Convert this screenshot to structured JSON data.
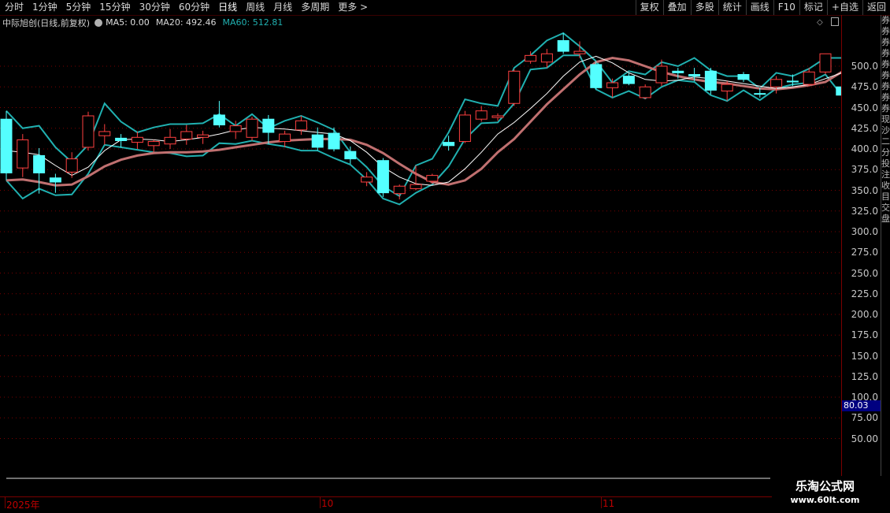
{
  "toolbar": {
    "periods": [
      "分时",
      "1分钟",
      "5分钟",
      "15分钟",
      "30分钟",
      "60分钟",
      "日线",
      "周线",
      "月线",
      "多周期",
      "更多 >"
    ],
    "active_period": "日线",
    "actions": [
      "复权",
      "叠加",
      "多股",
      "统计",
      "画线",
      "F10",
      "标记",
      "+自选",
      "返回"
    ]
  },
  "legend": {
    "title": "中际旭创(日线,前复权)",
    "ma5": "MA5: 0.00",
    "ma20": "MA20: 492.46",
    "ma60": "MA60: 512.81"
  },
  "price_axis": {
    "labels": [
      "500.0",
      "475.0",
      "450.0",
      "425.0",
      "400.0",
      "375.0",
      "350.0",
      "325.0",
      "300.0",
      "275.0",
      "250.0",
      "225.0",
      "200.0",
      "175.0",
      "150.0",
      "125.0",
      "100.0",
      "75.00",
      "50.00"
    ],
    "current_price": "80.03"
  },
  "side_strip": [
    "券",
    "券",
    "券",
    "券",
    "券",
    "券",
    "券",
    "券",
    "券",
    "现",
    "沙",
    "二",
    "分",
    "投",
    "注",
    "收",
    "目",
    "交",
    "盘"
  ],
  "time_axis": {
    "labels": [
      "2025年",
      "10",
      "11"
    ]
  },
  "watermark": {
    "line1": "乐淘公式网",
    "line2": "www.60lt.com"
  },
  "colors": {
    "up": "#ff4040",
    "down": "#54ffff",
    "ma_white": "#ffffff",
    "ma_brown": "#c07070",
    "band": "#20b0b0",
    "grid": "#7a0000"
  },
  "chart_data": {
    "type": "candlestick",
    "ylim": [
      25,
      550
    ],
    "candles": [
      {
        "o": 436,
        "h": 446,
        "l": 362,
        "c": 371
      },
      {
        "o": 377,
        "h": 418,
        "l": 366,
        "c": 411
      },
      {
        "o": 392,
        "h": 401,
        "l": 346,
        "c": 371
      },
      {
        "o": 365,
        "h": 370,
        "l": 347,
        "c": 360
      },
      {
        "o": 372,
        "h": 396,
        "l": 365,
        "c": 388
      },
      {
        "o": 402,
        "h": 445,
        "l": 398,
        "c": 440
      },
      {
        "o": 416,
        "h": 430,
        "l": 405,
        "c": 421
      },
      {
        "o": 413,
        "h": 418,
        "l": 402,
        "c": 410
      },
      {
        "o": 408,
        "h": 421,
        "l": 400,
        "c": 414
      },
      {
        "o": 404,
        "h": 411,
        "l": 396,
        "c": 409
      },
      {
        "o": 406,
        "h": 424,
        "l": 400,
        "c": 414
      },
      {
        "o": 412,
        "h": 429,
        "l": 405,
        "c": 421
      },
      {
        "o": 414,
        "h": 422,
        "l": 406,
        "c": 417
      },
      {
        "o": 441,
        "h": 458,
        "l": 426,
        "c": 429
      },
      {
        "o": 421,
        "h": 434,
        "l": 412,
        "c": 428
      },
      {
        "o": 414,
        "h": 439,
        "l": 410,
        "c": 436
      },
      {
        "o": 436,
        "h": 441,
        "l": 406,
        "c": 420
      },
      {
        "o": 409,
        "h": 422,
        "l": 402,
        "c": 418
      },
      {
        "o": 423,
        "h": 440,
        "l": 417,
        "c": 434
      },
      {
        "o": 417,
        "h": 426,
        "l": 398,
        "c": 402
      },
      {
        "o": 419,
        "h": 426,
        "l": 397,
        "c": 400
      },
      {
        "o": 397,
        "h": 403,
        "l": 382,
        "c": 388
      },
      {
        "o": 360,
        "h": 372,
        "l": 355,
        "c": 366
      },
      {
        "o": 386,
        "h": 389,
        "l": 342,
        "c": 347
      },
      {
        "o": 346,
        "h": 357,
        "l": 339,
        "c": 355
      },
      {
        "o": 352,
        "h": 380,
        "l": 350,
        "c": 357
      },
      {
        "o": 361,
        "h": 370,
        "l": 358,
        "c": 368
      },
      {
        "o": 408,
        "h": 416,
        "l": 398,
        "c": 404
      },
      {
        "o": 409,
        "h": 446,
        "l": 407,
        "c": 441
      },
      {
        "o": 436,
        "h": 452,
        "l": 433,
        "c": 446
      },
      {
        "o": 438,
        "h": 443,
        "l": 434,
        "c": 440
      },
      {
        "o": 455,
        "h": 496,
        "l": 452,
        "c": 494
      },
      {
        "o": 506,
        "h": 518,
        "l": 503,
        "c": 513
      },
      {
        "o": 505,
        "h": 521,
        "l": 498,
        "c": 515
      },
      {
        "o": 531,
        "h": 540,
        "l": 515,
        "c": 518
      },
      {
        "o": 515,
        "h": 530,
        "l": 510,
        "c": 518
      },
      {
        "o": 502,
        "h": 506,
        "l": 472,
        "c": 474
      },
      {
        "o": 474,
        "h": 485,
        "l": 462,
        "c": 480
      },
      {
        "o": 488,
        "h": 492,
        "l": 477,
        "c": 479
      },
      {
        "o": 462,
        "h": 478,
        "l": 460,
        "c": 475
      },
      {
        "o": 480,
        "h": 508,
        "l": 476,
        "c": 500
      },
      {
        "o": 494,
        "h": 498,
        "l": 485,
        "c": 492
      },
      {
        "o": 490,
        "h": 498,
        "l": 482,
        "c": 488
      },
      {
        "o": 494,
        "h": 498,
        "l": 466,
        "c": 471
      },
      {
        "o": 470,
        "h": 482,
        "l": 458,
        "c": 478
      },
      {
        "o": 490,
        "h": 493,
        "l": 481,
        "c": 484
      },
      {
        "o": 467,
        "h": 474,
        "l": 462,
        "c": 466
      },
      {
        "o": 475,
        "h": 488,
        "l": 467,
        "c": 484
      },
      {
        "o": 482,
        "h": 490,
        "l": 476,
        "c": 481
      },
      {
        "o": 478,
        "h": 498,
        "l": 476,
        "c": 493
      },
      {
        "o": 493,
        "h": 510,
        "l": 490,
        "c": 515
      },
      {
        "o": 475,
        "h": 483,
        "l": 462,
        "c": 465
      }
    ],
    "ma_white": [
      398,
      396,
      393,
      380,
      368,
      378,
      398,
      411,
      412,
      411,
      409,
      411,
      414,
      418,
      423,
      426,
      425,
      424,
      422,
      420,
      418,
      410,
      396,
      378,
      366,
      358,
      356,
      360,
      376,
      396,
      418,
      432,
      449,
      467,
      488,
      505,
      512,
      504,
      492,
      484,
      482,
      483,
      487,
      485,
      482,
      479,
      476,
      473,
      475,
      478,
      485,
      492
    ],
    "ma_brown": [
      362,
      363,
      360,
      356,
      357,
      367,
      379,
      387,
      392,
      395,
      396,
      396,
      397,
      399,
      402,
      405,
      408,
      410,
      411,
      412,
      412,
      411,
      405,
      395,
      382,
      370,
      360,
      357,
      362,
      376,
      396,
      412,
      433,
      454,
      472,
      490,
      505,
      510,
      507,
      500,
      493,
      488,
      484,
      481,
      479,
      476,
      473,
      472,
      474,
      477,
      481,
      493
    ],
    "band_upper": [
      446,
      425,
      428,
      402,
      384,
      405,
      455,
      433,
      420,
      426,
      430,
      430,
      431,
      442,
      428,
      442,
      425,
      434,
      440,
      432,
      423,
      396,
      378,
      355,
      343,
      380,
      388,
      420,
      460,
      455,
      452,
      498,
      513,
      531,
      540,
      524,
      506,
      480,
      494,
      490,
      505,
      500,
      510,
      495,
      488,
      488,
      473,
      492,
      488,
      497,
      510,
      510
    ],
    "band_lower": [
      362,
      340,
      352,
      344,
      345,
      370,
      405,
      402,
      399,
      396,
      395,
      391,
      392,
      407,
      406,
      410,
      406,
      403,
      398,
      398,
      389,
      381,
      363,
      340,
      333,
      347,
      357,
      379,
      412,
      431,
      432,
      455,
      496,
      498,
      513,
      513,
      472,
      462,
      470,
      461,
      475,
      483,
      481,
      465,
      458,
      471,
      459,
      473,
      478,
      480,
      490,
      465
    ]
  }
}
